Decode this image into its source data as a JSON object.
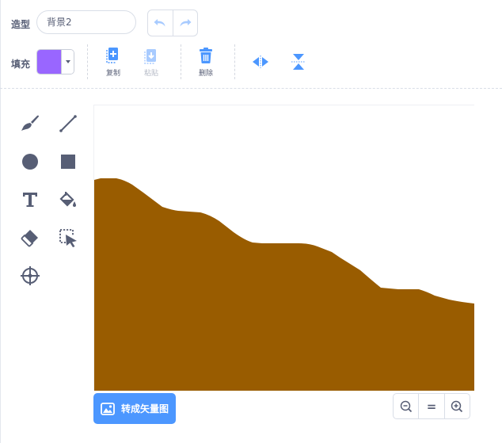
{
  "costume": {
    "label": "造型",
    "name_value": "背景2"
  },
  "fill": {
    "label": "填充",
    "color": "#9966ff"
  },
  "toolbar": {
    "copy_label": "复制",
    "paste_label": "粘贴",
    "delete_label": "删除",
    "accent_color": "#4c97ff"
  },
  "canvas": {
    "fill_color": "#995c00"
  },
  "convert_button": {
    "label": "转成矢量图"
  },
  "zoom": {
    "reset_label": "="
  }
}
